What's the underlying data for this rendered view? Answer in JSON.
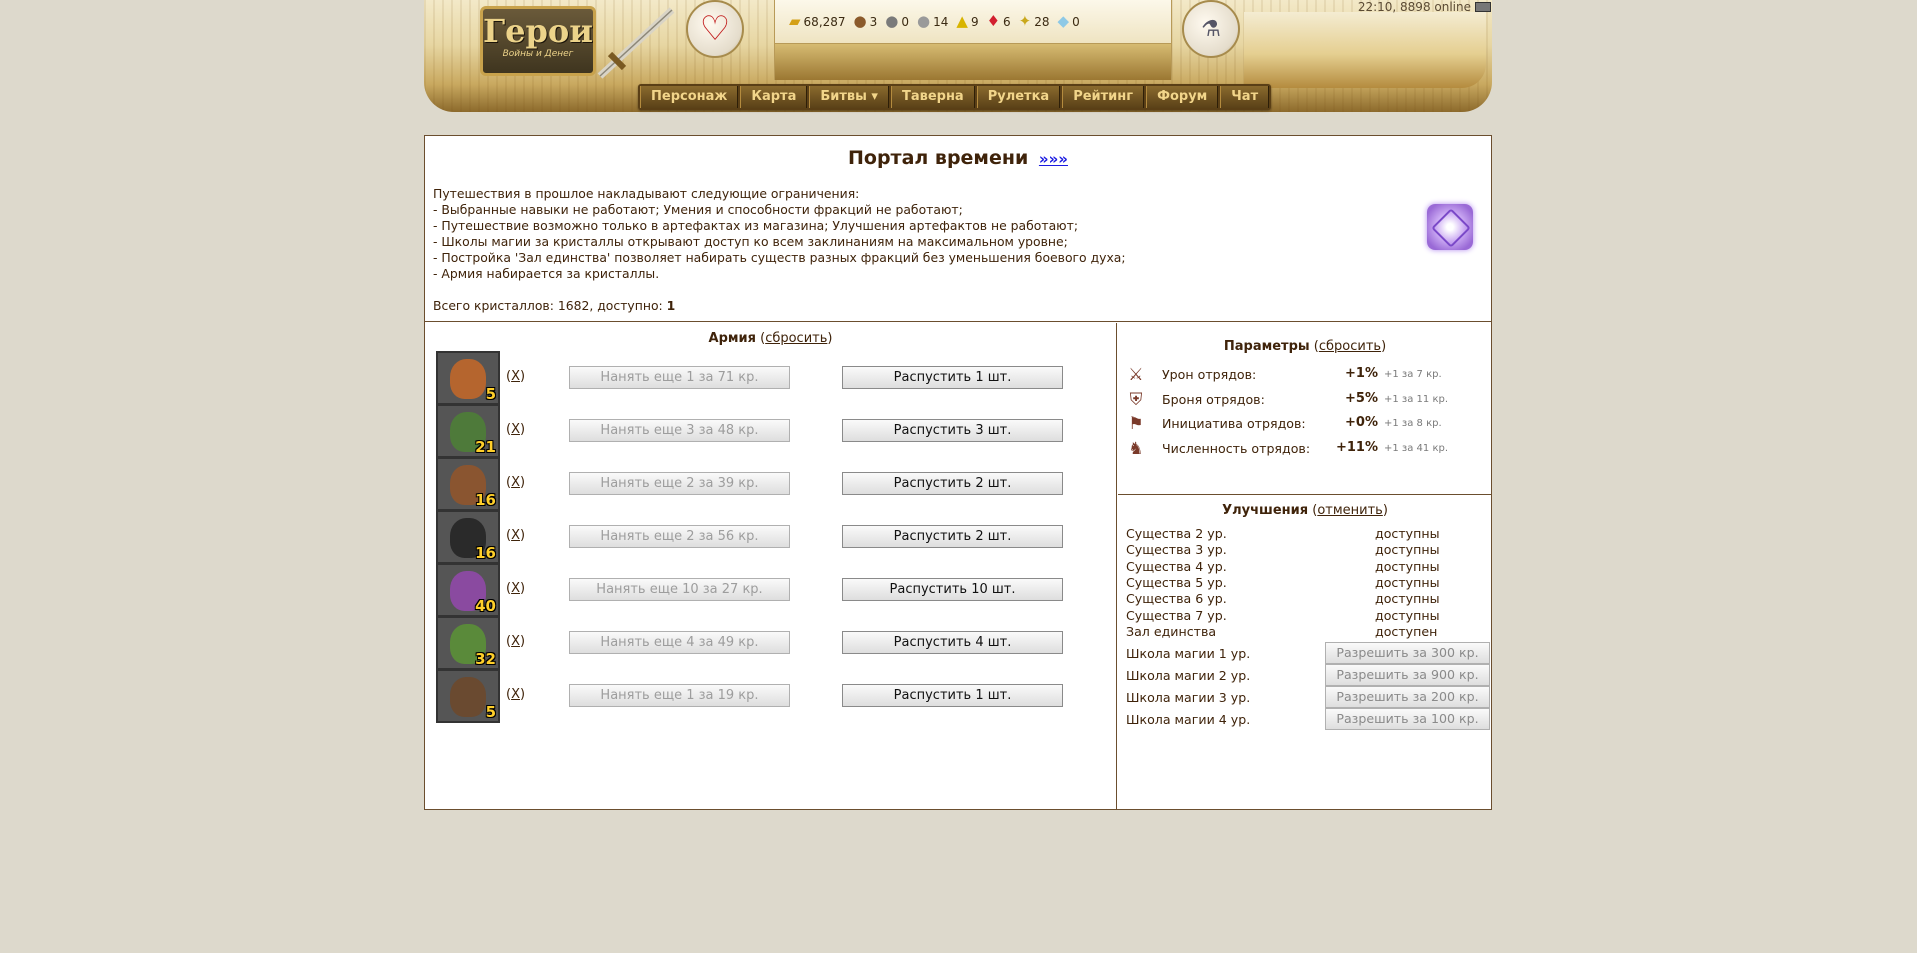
{
  "header": {
    "logo_title": "Герои",
    "logo_subtitle": "Войны и Денег",
    "status": "22:10, 8898 online",
    "resources": [
      {
        "icon": "gold-icon",
        "glyph": "▰",
        "color": "#d4a017",
        "value": "68,287"
      },
      {
        "icon": "wood-icon",
        "glyph": "●",
        "color": "#8b5a2b",
        "value": "3"
      },
      {
        "icon": "ore-icon",
        "glyph": "●",
        "color": "#7a7a7a",
        "value": "0"
      },
      {
        "icon": "mercury-icon",
        "glyph": "●",
        "color": "#9a9a9a",
        "value": "14"
      },
      {
        "icon": "sulfur-icon",
        "glyph": "▲",
        "color": "#d8b400",
        "value": "9"
      },
      {
        "icon": "crystals-icon",
        "glyph": "♦",
        "color": "#d21f2f",
        "value": "6"
      },
      {
        "icon": "gems-icon",
        "glyph": "✦",
        "color": "#c9a81c",
        "value": "28"
      },
      {
        "icon": "diamond-icon",
        "glyph": "◆",
        "color": "#8ec9e6",
        "value": "0"
      }
    ],
    "nav": [
      {
        "name": "nav-character",
        "label": "Персонаж"
      },
      {
        "name": "nav-map",
        "label": "Карта"
      },
      {
        "name": "nav-battles",
        "label": "Битвы ▾"
      },
      {
        "name": "nav-tavern",
        "label": "Таверна"
      },
      {
        "name": "nav-roulette",
        "label": "Рулетка"
      },
      {
        "name": "nav-rating",
        "label": "Рейтинг"
      },
      {
        "name": "nav-forum",
        "label": "Форум"
      },
      {
        "name": "nav-chat",
        "label": "Чат"
      }
    ]
  },
  "portal": {
    "title": "Портал времени",
    "title_link": "»»»",
    "intro": "Путешествия в прошлое накладывают следующие ограничения:",
    "rules": [
      "- Выбранные навыки не работают; Умения и способности фракций не работают;",
      "- Путешествие возможно только в артефактах из магазина; Улучшения артефактов не работают;",
      "- Школы магии за кристаллы открывают доступ ко всем заклинаниям на максимальном уровне;",
      "- Постройка 'Зал единства' позволяет набирать существ разных фракций без уменьшения боевого духа;",
      "- Армия набирается за кристаллы."
    ],
    "total_label": "Всего кристаллов: 1682, доступно:",
    "total_available": "1"
  },
  "army": {
    "title": "Армия",
    "reset": "сбросить",
    "units": [
      {
        "count": "5",
        "x": "X",
        "hire": "Нанять еще 1 за 71 кр.",
        "dismiss": "Распустить 1 шт.",
        "color": "#b5652e"
      },
      {
        "count": "21",
        "x": "X",
        "hire": "Нанять еще 3 за 48 кр.",
        "dismiss": "Распустить 3 шт.",
        "color": "#4e7a3a"
      },
      {
        "count": "16",
        "x": "X",
        "hire": "Нанять еще 2 за 39 кр.",
        "dismiss": "Распустить 2 шт.",
        "color": "#8a5530"
      },
      {
        "count": "16",
        "x": "X",
        "hire": "Нанять еще 2 за 56 кр.",
        "dismiss": "Распустить 2 шт.",
        "color": "#2a2a2a"
      },
      {
        "count": "40",
        "x": "X",
        "hire": "Нанять еще 10 за 27 кр.",
        "dismiss": "Распустить 10 шт.",
        "color": "#8a4aa0"
      },
      {
        "count": "32",
        "x": "X",
        "hire": "Нанять еще 4 за 49 кр.",
        "dismiss": "Распустить 4 шт.",
        "color": "#5a8a3a"
      },
      {
        "count": "5",
        "x": "X",
        "hire": "Нанять еще 1 за 19 кр.",
        "dismiss": "Распустить 1 шт.",
        "color": "#6a4a30"
      }
    ]
  },
  "params": {
    "title": "Параметры",
    "reset": "сбросить",
    "items": [
      {
        "icon": "sword-damage-icon",
        "glyph": "⚔",
        "label": "Урон отрядов:",
        "value": "+1%",
        "cost": "+1 за 7 кр."
      },
      {
        "icon": "armor-icon",
        "glyph": "⛨",
        "label": "Броня отрядов:",
        "value": "+5%",
        "cost": "+1 за 11 кр."
      },
      {
        "icon": "initiative-icon",
        "glyph": "⚑",
        "label": "Инициатива отрядов:",
        "value": "+0%",
        "cost": "+1 за 8 кр."
      },
      {
        "icon": "troops-count-icon",
        "glyph": "♞",
        "label": "Численность отрядов:",
        "value": "+11%",
        "cost": "+1 за 41 кр."
      }
    ]
  },
  "upgrades": {
    "title": "Улучшения",
    "cancel": "отменить",
    "levels": [
      {
        "label": "Существа 2 ур.",
        "status": "доступны"
      },
      {
        "label": "Существа 3 ур.",
        "status": "доступны"
      },
      {
        "label": "Существа 4 ур.",
        "status": "доступны"
      },
      {
        "label": "Существа 5 ур.",
        "status": "доступны"
      },
      {
        "label": "Существа 6 ур.",
        "status": "доступны"
      },
      {
        "label": "Существа 7 ур.",
        "status": "доступны"
      },
      {
        "label": "Зал единства",
        "status": "доступен"
      }
    ],
    "schools": [
      {
        "label": "Школа магии 1 ур.",
        "button": "Разрешить за 300 кр."
      },
      {
        "label": "Школа магии 2 ур.",
        "button": "Разрешить за 900 кр."
      },
      {
        "label": "Школа магии 3 ур.",
        "button": "Разрешить за 200 кр."
      },
      {
        "label": "Школа магии 4 ур.",
        "button": "Разрешить за 100 кр."
      }
    ]
  }
}
